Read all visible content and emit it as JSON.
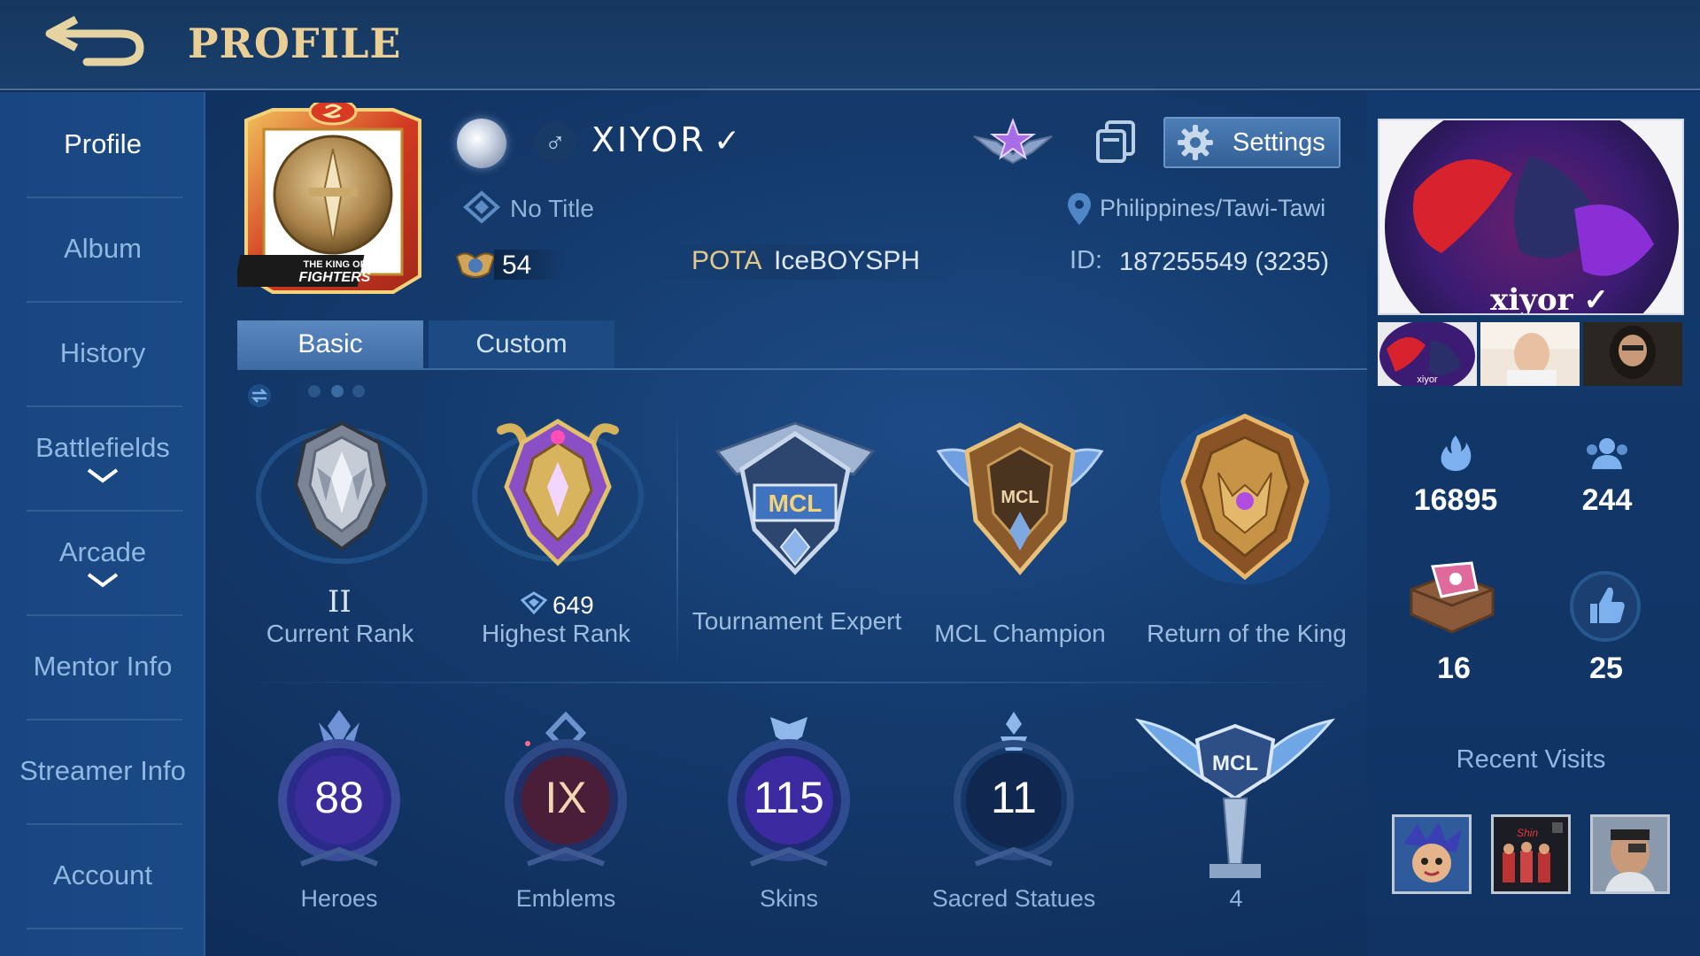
{
  "header": {
    "title": "PROFILE",
    "back_icon": "back-arrow-icon"
  },
  "sidebar": {
    "items": [
      {
        "label": "Profile",
        "active": true,
        "expandable": false
      },
      {
        "label": "Album",
        "active": false,
        "expandable": false
      },
      {
        "label": "History",
        "active": false,
        "expandable": false
      },
      {
        "label": "Battlefields",
        "active": false,
        "expandable": true
      },
      {
        "label": "Arcade",
        "active": false,
        "expandable": true
      },
      {
        "label": "Mentor Info",
        "active": false,
        "expandable": false
      },
      {
        "label": "Streamer Info",
        "active": false,
        "expandable": false
      },
      {
        "label": "Account",
        "active": false,
        "expandable": false
      }
    ]
  },
  "profile": {
    "avatar_frame_text": "THE KING OF FIGHTERS",
    "gender_symbol": "♂",
    "name": "XIYOR",
    "verified_mark": "✓",
    "title": "No Title",
    "level": "54",
    "squad_tag": "POTA",
    "squad_name": "IceBOYSPH",
    "location": "Philippines/Tawi-Tawi",
    "id_label": "ID:",
    "id_value": "187255549 (3235)",
    "settings_label": "Settings"
  },
  "tabs": [
    {
      "label": "Basic",
      "active": true
    },
    {
      "label": "Custom",
      "active": false
    }
  ],
  "pager": {
    "pages": 3,
    "current": 1
  },
  "achievements": [
    {
      "label": "Current Rank",
      "tier": "II"
    },
    {
      "label": "Highest Rank",
      "stars": "649"
    },
    {
      "label": "Tournament Expert",
      "emblem_text": "MCL"
    },
    {
      "label": "MCL Champion",
      "emblem_text": "MCL"
    },
    {
      "label": "Return of the King"
    }
  ],
  "stats": [
    {
      "label": "Heroes",
      "value": "88"
    },
    {
      "label": "Emblems",
      "value": "IX"
    },
    {
      "label": "Skins",
      "value": "115"
    },
    {
      "label": "Sacred Statues",
      "value": "11"
    },
    {
      "label": "4",
      "emblem_text": "MCL"
    }
  ],
  "right_panel": {
    "cover_caption": "xiyor ✓",
    "thumb_caption": "xiyor",
    "popularity": "16895",
    "followers": "244",
    "gifts": "16",
    "likes": "25",
    "recent_visits_title": "Recent Visits",
    "visit_badge": "Shin"
  },
  "colors": {
    "accent_gold": "#e9cf95",
    "label_blue": "#9cbde0",
    "button_blue": "#4d7eb6"
  }
}
